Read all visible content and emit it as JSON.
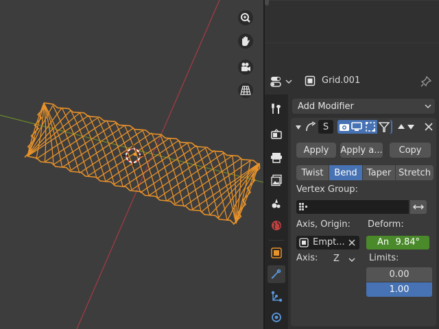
{
  "window": {
    "object_name": "Grid.001"
  },
  "viewport": {
    "nav_icons": [
      "zoom-icon",
      "hand-pan-icon",
      "camera-icon",
      "grid-view-icon"
    ],
    "colors": {
      "background": "#3d3d3d",
      "x_axis": "#a83a46",
      "y_axis": "#6a8a2a",
      "mesh": "#e8922a"
    }
  },
  "properties": {
    "add_modifier_label": "Add Modifier",
    "modifier": {
      "name": "S",
      "apply_label": "Apply",
      "apply_as_label": "Apply a...",
      "copy_label": "Copy",
      "modes": [
        "Twist",
        "Bend",
        "Taper",
        "Stretch"
      ],
      "active_mode": "Bend",
      "vertex_group_label": "Vertex Group:",
      "vertex_group_value": "",
      "axis_origin_label": "Axis, Origin:",
      "origin_object": "Empt...",
      "deform_label": "Deform:",
      "angle_label": "An",
      "angle_value": "9.84°",
      "axis_label": "Axis:",
      "axis_value": "Z",
      "limits_label": "Limits:",
      "limit_min": "0.00",
      "limit_max": "1.00"
    },
    "tabs": [
      "tool-icon",
      "render-icon",
      "output-icon",
      "view-layer-icon",
      "scene-icon",
      "world-icon",
      "object-icon",
      "modifier-icon",
      "particles-icon",
      "physics-icon"
    ],
    "active_tab": "modifier-icon",
    "colors": {
      "accent_blue": "#4772b3",
      "deform_green": "#4a8a2a",
      "panel": "#303030",
      "button": "#545454"
    }
  }
}
